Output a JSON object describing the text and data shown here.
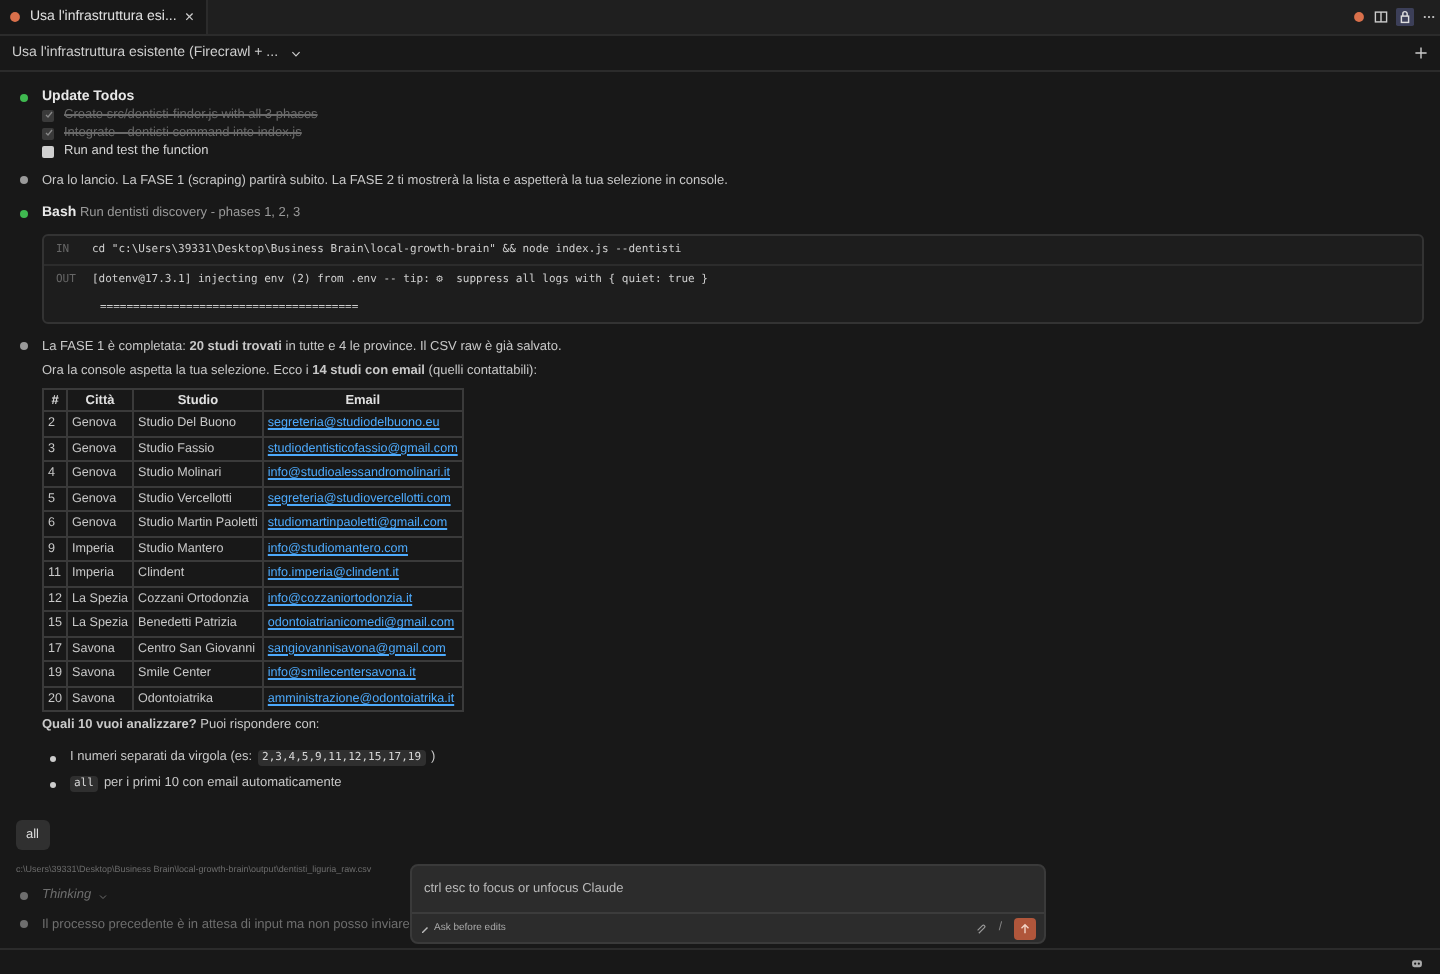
{
  "tab": {
    "title": "Usa l'infrastruttura esi...",
    "close": "×"
  },
  "header": {
    "title": "Usa l'infrastruttura esistente (Firecrawl + ..."
  },
  "todos": {
    "title": "Update Todos",
    "color": "#3fb950",
    "items": [
      {
        "label": "Create src/dentisti-finder.js with all 3 phases",
        "checked": true
      },
      {
        "label": "Integrate --dentisti command into index.js",
        "checked": true
      },
      {
        "label": "Run and test the function",
        "checked": false
      }
    ]
  },
  "intro": {
    "text": "Ora lo lancio. La FASE 1 (scraping) partirà subito. La FASE 2 ti mostrerà la lista e aspetterà la tua selezione in console.",
    "color": "#9a9a9a"
  },
  "bash": {
    "title": "Bash",
    "description": "Run dentisti discovery - phases 1, 2, 3",
    "color": "#3fb950",
    "in_label": "IN",
    "command": "cd \"c:\\Users\\39331\\Desktop\\Business Brain\\local-growth-brain\" && node index.js --dentisti",
    "out_label": "OUT",
    "output": "[dotenv@17.3.1] injecting env (2) from .env -- tip: ⚙  suppress all logs with { quiet: true }",
    "rule": "======================================="
  },
  "result": {
    "color": "#9a9a9a",
    "lines": [
      "La FASE 1 è completata: **20 studi trovati** in tutte e 4 le province. Il CSV raw è già salvato.",
      "Ora la console aspetta la tua selezione. Ecco i **14 studi con email** (quelli contattabili):"
    ],
    "table": {
      "columns": [
        "#",
        "Città",
        "Studio",
        "Email"
      ],
      "rows": [
        [
          "2",
          "Genova",
          "Studio Del Buono",
          "segreteria@studiodelbuono.eu"
        ],
        [
          "3",
          "Genova",
          "Studio Fassio",
          "studiodentisticofassio@gmail.com"
        ],
        [
          "4",
          "Genova",
          "Studio Molinari",
          "info@studioalessandromolinari.it"
        ],
        [
          "5",
          "Genova",
          "Studio Vercellotti",
          "segreteria@studiovercellotti.com"
        ],
        [
          "6",
          "Genova",
          "Studio Martin Paoletti",
          "studiomartinpaoletti@gmail.com"
        ],
        [
          "9",
          "Imperia",
          "Studio Mantero",
          "info@studiomantero.com"
        ],
        [
          "11",
          "Imperia",
          "Clindent",
          "info.imperia@clindent.it"
        ],
        [
          "12",
          "La Spezia",
          "Cozzani Ortodonzia",
          "info@cozzaniortodonzia.it"
        ],
        [
          "15",
          "La Spezia",
          "Benedetti Patrizia",
          "odontoiatrianicomedi@gmail.com"
        ],
        [
          "17",
          "Savona",
          "Centro San Giovanni",
          "sangiovannisavona@gmail.com"
        ],
        [
          "19",
          "Savona",
          "Smile Center",
          "info@smilecentersavona.it"
        ],
        [
          "20",
          "Savona",
          "Odontoiatrika",
          "amministrazione@odontoiatrika.it"
        ]
      ]
    },
    "question": "**Quali 10 vuoi analizzare?** Puoi rispondere con:",
    "bullets": [
      [
        {
          "kind": "text",
          "text": "I numeri separati da virgola (es:"
        },
        {
          "kind": "code",
          "text": "2,3,4,5,9,11,12,15,17,19"
        },
        {
          "kind": "text",
          "text": ")"
        }
      ],
      [
        {
          "kind": "code",
          "text": "all"
        },
        {
          "kind": "text",
          "text": "per i primi 10 con email automaticamente"
        }
      ]
    ]
  },
  "user_message": "all",
  "path": "c:\\Users\\39331\\Desktop\\Business Brain\\local-growth-brain\\output\\dentisti_liguria_raw.csv",
  "thinking": {
    "label": "Thinking",
    "color": "#6e6e6e"
  },
  "last": {
    "text": "Il processo precedente è in attesa di input ma non posso inviare",
    "color": "#6e6e6e"
  },
  "composer": {
    "placeholder": "ctrl esc to focus or unfocus Claude",
    "mode": "Ask before edits",
    "slash": "/"
  }
}
